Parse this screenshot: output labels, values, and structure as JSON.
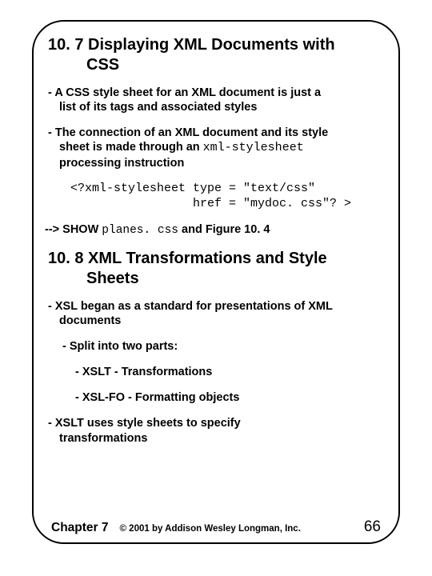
{
  "section1": {
    "number": "10. 7",
    "title_line1": "Displaying XML Documents with",
    "title_line2": "CSS"
  },
  "bullet1": {
    "line1": "- A CSS style sheet for an XML document is just a",
    "line2": "list of its tags and associated styles"
  },
  "bullet2": {
    "line1": "- The connection of an XML document and its style",
    "line2a": "sheet is made through an ",
    "line2code": "xml-stylesheet",
    "line3": "processing instruction"
  },
  "code": {
    "line1": "<?xml-stylesheet type = \"text/css\"",
    "line2": "                 href = \"mydoc. css\"? >"
  },
  "show": {
    "prefix": "--> SHOW ",
    "code": "planes. css",
    "suffix": " and Figure 10. 4"
  },
  "section2": {
    "number": "10. 8",
    "title_line1": "XML Transformations and Style",
    "title_line2": "Sheets"
  },
  "bullet3": {
    "line1": "- XSL began as a standard for presentations of XML",
    "line2": "documents"
  },
  "bullet4": "- Split into two parts:",
  "bullet5": "- XSLT - Transformations",
  "bullet6": "- XSL-FO - Formatting objects",
  "bullet7": {
    "line1": "- XSLT uses style sheets to specify",
    "line2": "transformations"
  },
  "footer": {
    "chapter": "Chapter 7",
    "copyright": "© 2001 by Addison Wesley Longman, Inc.",
    "page": "66"
  }
}
